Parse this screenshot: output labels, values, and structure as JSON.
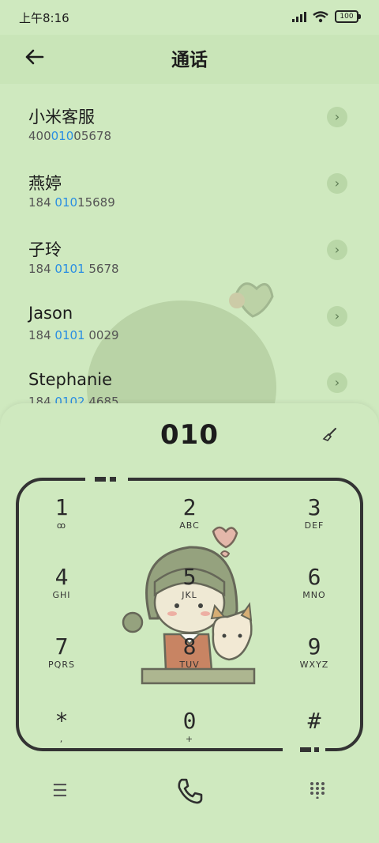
{
  "status": {
    "time": "上午8:16",
    "battery": "100"
  },
  "header": {
    "title": "通话"
  },
  "contacts": [
    {
      "name": "小米客服",
      "num_pre": "400",
      "num_hl": "010",
      "num_post": "05678"
    },
    {
      "name": "燕婷",
      "num_pre": "184 ",
      "num_hl": "010",
      "num_post": "15689"
    },
    {
      "name": "子玲",
      "num_pre": "184 ",
      "num_hl": "0101",
      "num_post": " 5678"
    },
    {
      "name": "Jason",
      "num_pre": "184 ",
      "num_hl": "0101",
      "num_post": " 0029"
    },
    {
      "name": "Stephanie",
      "num_pre": "184 ",
      "num_hl": "0102",
      "num_post": " 4685"
    }
  ],
  "dialer": {
    "digits": "010",
    "keys": [
      {
        "d": "1",
        "l": "ꝏ"
      },
      {
        "d": "2",
        "l": "ABC"
      },
      {
        "d": "3",
        "l": "DEF"
      },
      {
        "d": "4",
        "l": "GHI"
      },
      {
        "d": "5",
        "l": "JKL"
      },
      {
        "d": "6",
        "l": "MNO"
      },
      {
        "d": "7",
        "l": "PQRS"
      },
      {
        "d": "8",
        "l": "TUV"
      },
      {
        "d": "9",
        "l": "WXYZ"
      },
      {
        "d": "*",
        "l": ","
      },
      {
        "d": "0",
        "l": "+"
      },
      {
        "d": "#",
        "l": ""
      }
    ]
  },
  "colors": {
    "highlight": "#2a8ee2",
    "background": "#cfe9bf"
  },
  "icons": [
    "back-arrow-icon",
    "chevron-right-icon",
    "clear-brush-icon",
    "menu-icon",
    "phone-call-icon",
    "dialpad-icon"
  ]
}
